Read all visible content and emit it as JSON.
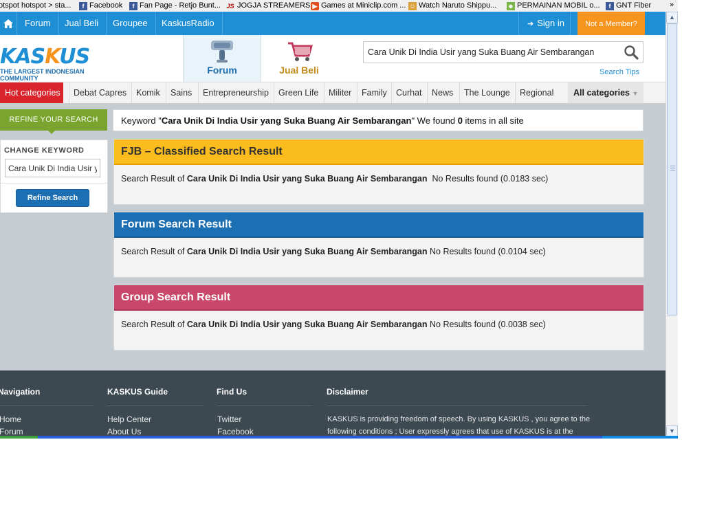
{
  "bookmarks": [
    {
      "label": "otspot hotspot > sta...",
      "icon": "none"
    },
    {
      "label": "Facebook",
      "icon": "facebook-icon"
    },
    {
      "label": "Fan Page - Retjo Bunt...",
      "icon": "facebook-icon"
    },
    {
      "label": "JOGJA STREAMERS",
      "icon": "js-icon"
    },
    {
      "label": "Games at Miniclip.com ...",
      "icon": "play-icon"
    },
    {
      "label": "Watch Naruto Shippu...",
      "icon": "naruto-icon"
    },
    {
      "label": "PERMAINAN MOBIL o...",
      "icon": "android-icon"
    },
    {
      "label": "GNT Fiber",
      "icon": "facebook-icon"
    }
  ],
  "bookmarks_more": "»",
  "topnav": {
    "items": [
      "Forum",
      "Jual Beli",
      "Groupee",
      "KaskusRadio"
    ],
    "sign_in": "Sign in",
    "not_member": "Not a Member?"
  },
  "header": {
    "logo_text": "KASKUS",
    "logo_tagline": "THE LARGEST INDONESIAN COMMUNITY",
    "tab_forum": "Forum",
    "tab_jualbeli": "Jual Beli",
    "search_value": "Cara Unik Di India Usir yang Suka Buang Air Sembarangan",
    "search_tips": "Search Tips"
  },
  "categories": {
    "hot": "Hot categories",
    "items": [
      "Debat Capres",
      "Komik",
      "Sains",
      "Entrepreneurship",
      "Green Life",
      "Militer",
      "Family",
      "Curhat",
      "News",
      "The Lounge",
      "Regional"
    ],
    "all": "All categories"
  },
  "refine": {
    "label": "REFINE YOUR SEARCH",
    "change_keyword": "CHANGE KEYWORD",
    "keyword_value": "Cara Unik Di India Usir yang Suka Buang Air Sembarangan",
    "button": "Refine Search"
  },
  "summary": {
    "prefix": "Keyword \"",
    "keyword": "Cara Unik Di India Usir yang Suka Buang Air Sembarangan",
    "middle": "\" We found ",
    "count": "0",
    "suffix": " items in all site"
  },
  "results": [
    {
      "title": "FJB – Classified Search Result",
      "prefix": "Search Result of ",
      "keyword": "Cara Unik Di India Usir yang Suka Buang Air Sembarangan",
      "status": "  No Results found (0.0183 sec)"
    },
    {
      "title": "Forum Search Result",
      "prefix": "Search Result of ",
      "keyword": "Cara Unik Di India Usir yang Suka Buang Air Sembarangan",
      "status": " No Results found (0.0104 sec)"
    },
    {
      "title": "Group Search Result",
      "prefix": "Search Result of ",
      "keyword": "Cara Unik Di India Usir yang Suka Buang Air Sembarangan",
      "status": " No Results found (0.0038 sec)"
    }
  ],
  "footer": {
    "navigation": {
      "title": "Navigation",
      "links": [
        "Home",
        "Forum"
      ]
    },
    "guide": {
      "title": "KASKUS Guide",
      "links": [
        "Help Center",
        "About Us"
      ]
    },
    "findus": {
      "title": "Find Us",
      "links": [
        "Twitter",
        "Facebook"
      ]
    },
    "disclaimer": {
      "title": "Disclaimer",
      "text": "KASKUS is providing freedom of speech. By using KASKUS , you agree to the following conditions ; User expressly agrees that use of KASKUS is at the"
    }
  },
  "colors": {
    "brand_blue": "#1e8fd4",
    "brand_orange": "#f7941d",
    "fjb": "#fbbd1e",
    "forum": "#1d6fb3",
    "group": "#c8476a",
    "refine_green": "#79a42d"
  }
}
